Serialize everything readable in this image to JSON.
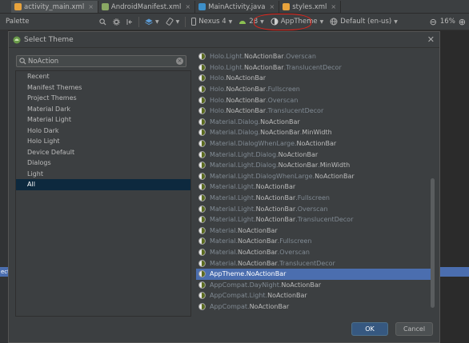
{
  "tabs": [
    {
      "label": "activity_main.xml",
      "icon": "xml-file-icon",
      "color": "#e8a33c",
      "active": true
    },
    {
      "label": "AndroidManifest.xml",
      "icon": "manifest-file-icon",
      "color": "#8aa863"
    },
    {
      "label": "MainActivity.java",
      "icon": "java-class-icon",
      "color": "#3d8fc9"
    },
    {
      "label": "styles.xml",
      "icon": "xml-file-icon",
      "color": "#e8a33c"
    }
  ],
  "toolbar": {
    "palette_label": "Palette",
    "device": "Nexus 4",
    "api": "28",
    "theme": "AppTheme",
    "locale": "Default (en-us)",
    "zoom": "16%"
  },
  "dialog": {
    "title": "Select Theme",
    "search_value": "NoAction",
    "categories": [
      "Recent",
      "Manifest Themes",
      "Project Themes",
      "Material Dark",
      "Material Light",
      "Holo Dark",
      "Holo Light",
      "Device Default",
      "Dialogs",
      "Light",
      "All"
    ],
    "selected_category": "All",
    "themes": [
      {
        "p1": "Holo.Light.",
        "h1": "NoActionBar",
        "p2": ".Overscan",
        "h2": ""
      },
      {
        "p1": "Holo.Light.",
        "h1": "NoActionBar",
        "p2": ".TranslucentDecor",
        "h2": ""
      },
      {
        "p1": "Holo.",
        "h1": "NoActionBar",
        "p2": "",
        "h2": ""
      },
      {
        "p1": "Holo.",
        "h1": "NoActionBar",
        "p2": ".Fullscreen",
        "h2": ""
      },
      {
        "p1": "Holo.",
        "h1": "NoActionBar",
        "p2": ".Overscan",
        "h2": ""
      },
      {
        "p1": "Holo.",
        "h1": "NoActionBar",
        "p2": ".TranslucentDecor",
        "h2": ""
      },
      {
        "p1": "Material.Dialog.",
        "h1": "NoActionBar",
        "p2": "",
        "h2": ""
      },
      {
        "p1": "Material.Dialog.",
        "h1": "NoActionBar",
        "p2": ".",
        "h2": "MinWidth"
      },
      {
        "p1": "Material.DialogWhenLarge.",
        "h1": "NoActionBar",
        "p2": "",
        "h2": ""
      },
      {
        "p1": "Material.Light.Dialog.",
        "h1": "NoActionBar",
        "p2": "",
        "h2": ""
      },
      {
        "p1": "Material.Light.Dialog.",
        "h1": "NoActionBar",
        "p2": ".",
        "h2": "MinWidth"
      },
      {
        "p1": "Material.Light.DialogWhenLarge.",
        "h1": "NoActionBar",
        "p2": "",
        "h2": ""
      },
      {
        "p1": "Material.Light.",
        "h1": "NoActionBar",
        "p2": "",
        "h2": ""
      },
      {
        "p1": "Material.Light.",
        "h1": "NoActionBar",
        "p2": ".Fullscreen",
        "h2": ""
      },
      {
        "p1": "Material.Light.",
        "h1": "NoActionBar",
        "p2": ".Overscan",
        "h2": ""
      },
      {
        "p1": "Material.Light.",
        "h1": "NoActionBar",
        "p2": ".TranslucentDecor",
        "h2": ""
      },
      {
        "p1": "Material.",
        "h1": "NoActionBar",
        "p2": "",
        "h2": ""
      },
      {
        "p1": "Material.",
        "h1": "NoActionBar",
        "p2": ".Fullscreen",
        "h2": ""
      },
      {
        "p1": "Material.",
        "h1": "NoActionBar",
        "p2": ".Overscan",
        "h2": ""
      },
      {
        "p1": "Material.",
        "h1": "NoActionBar",
        "p2": ".TranslucentDecor",
        "h2": ""
      },
      {
        "p1": "AppTheme.",
        "h1": "NoActionBar",
        "p2": "",
        "h2": "",
        "selected": true
      },
      {
        "p1": "AppCompat.DayNight.",
        "h1": "NoActionBar",
        "p2": "",
        "h2": ""
      },
      {
        "p1": "AppCompat.Light.",
        "h1": "NoActionBar",
        "p2": "",
        "h2": ""
      },
      {
        "p1": "AppCompat.",
        "h1": "NoActionBar",
        "p2": "",
        "h2": ""
      }
    ],
    "ok_label": "OK",
    "cancel_label": "Cancel"
  },
  "colors": {
    "accent": "#4b6eaf",
    "annotation_circle": "#e2231a",
    "selected_category_bg": "#0d293e",
    "ok_button": "#365880"
  }
}
